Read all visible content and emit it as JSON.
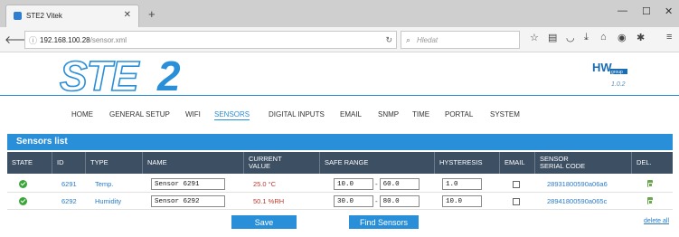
{
  "browser": {
    "tab_title": "STE2 Vitek",
    "url_host": "192.168.100.28",
    "url_path": "/sensor.xml",
    "search_placeholder": "Hledat"
  },
  "header": {
    "version": "1.0.2"
  },
  "menu": [
    "HOME",
    "GENERAL SETUP",
    "WIFI",
    "SENSORS",
    "DIGITAL INPUTS",
    "EMAIL",
    "SNMP",
    "TIME",
    "PORTAL",
    "SYSTEM"
  ],
  "menu_active": "SENSORS",
  "sensors": {
    "title": "Sensors list",
    "columns": {
      "state": "STATE",
      "id": "ID",
      "type": "TYPE",
      "name": "NAME",
      "current": "CURRENT\nVALUE",
      "safe_range": "SAFE RANGE",
      "hysteresis": "HYSTERESIS",
      "email": "EMAIL",
      "serial": "SENSOR\nSERIAL CODE",
      "del": "DEL."
    },
    "rows": [
      {
        "state": "ok",
        "id": "6291",
        "type": "Temp.",
        "name": "Sensor 6291",
        "value": "25.0 °C",
        "range_low": "10.0",
        "range_high": "60.0",
        "hysteresis": "1.0",
        "email": false,
        "serial": "28931800590a06a6"
      },
      {
        "state": "ok",
        "id": "6292",
        "type": "Humidity",
        "name": "Sensor 6292",
        "value": "50.1 %RH",
        "range_low": "30.0",
        "range_high": "80.0",
        "hysteresis": "10.0",
        "email": false,
        "serial": "28941800590a065c"
      }
    ],
    "save_label": "Save",
    "find_label": "Find Sensors",
    "delete_all_label": "delete all"
  },
  "colors": {
    "accent": "#2a8fd9",
    "table_header": "#3d4f63",
    "ok": "#3aa63a",
    "value": "#c0392b"
  }
}
